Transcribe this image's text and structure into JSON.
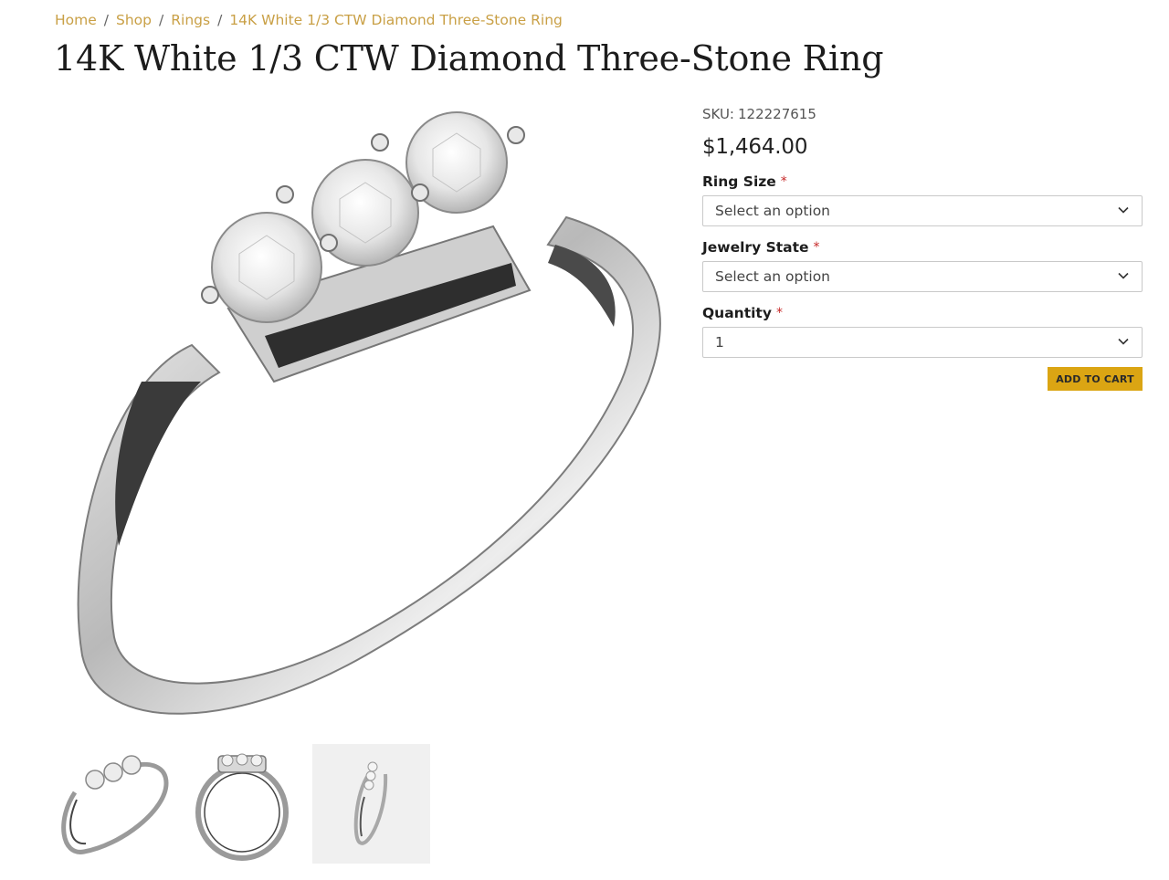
{
  "breadcrumb": {
    "items": [
      "Home",
      "Shop",
      "Rings",
      "14K White 1/3 CTW Diamond Three-Stone Ring"
    ],
    "separator": "/"
  },
  "product": {
    "title": "14K White 1/3 CTW Diamond Three-Stone Ring",
    "sku_label": "SKU:",
    "sku": "122227615",
    "price": "$1,464.00"
  },
  "options": {
    "required_mark": "*",
    "ring_size": {
      "label": "Ring Size",
      "value": "Select an option"
    },
    "jewelry_state": {
      "label": "Jewelry State",
      "value": "Select an option"
    },
    "quantity": {
      "label": "Quantity",
      "value": "1"
    }
  },
  "actions": {
    "add_to_cart": "ADD TO CART"
  },
  "gallery": {
    "thumbnails": [
      "ring-angle-view",
      "ring-front-view",
      "ring-side-view"
    ]
  },
  "colors": {
    "accent": "#c9a046",
    "button": "#dba513",
    "required": "#c62828"
  }
}
